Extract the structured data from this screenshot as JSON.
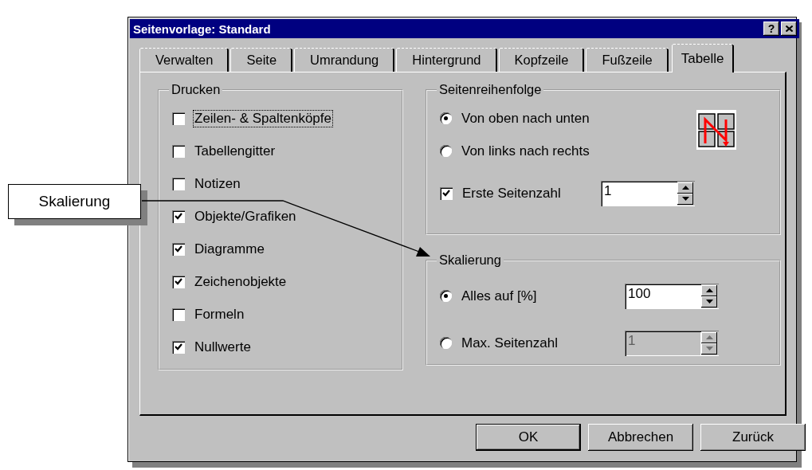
{
  "window": {
    "title": "Seitenvorlage: Standard",
    "help_button": "?"
  },
  "tabs": [
    {
      "label": "Verwalten",
      "selected": false
    },
    {
      "label": "Seite",
      "selected": false
    },
    {
      "label": "Umrandung",
      "selected": false
    },
    {
      "label": "Hintergrund",
      "selected": false
    },
    {
      "label": "Kopfzeile",
      "selected": false
    },
    {
      "label": "Fußzeile",
      "selected": false
    },
    {
      "label": "Tabelle",
      "selected": true
    }
  ],
  "print_group": {
    "title": "Drucken",
    "options": [
      {
        "label": "Zeilen- & Spaltenköpfe",
        "checked": false,
        "focused": true
      },
      {
        "label": "Tabellengitter",
        "checked": false,
        "focused": false
      },
      {
        "label": "Notizen",
        "checked": false,
        "focused": false
      },
      {
        "label": "Objekte/Grafiken",
        "checked": true,
        "focused": false
      },
      {
        "label": "Diagramme",
        "checked": true,
        "focused": false
      },
      {
        "label": "Zeichenobjekte",
        "checked": true,
        "focused": false
      },
      {
        "label": "Formeln",
        "checked": false,
        "focused": false
      },
      {
        "label": "Nullwerte",
        "checked": true,
        "focused": false
      }
    ]
  },
  "page_order": {
    "title": "Seitenreihenfolge",
    "options": [
      {
        "label": "Von oben nach unten",
        "selected": true
      },
      {
        "label": "Von links nach rechts",
        "selected": false
      }
    ],
    "first_page": {
      "label": "Erste Seitenzahl",
      "checked": true,
      "value": "1"
    }
  },
  "scaling": {
    "title": "Skalierung",
    "options": [
      {
        "label": "Alles auf [%]",
        "selected": true,
        "value": "100",
        "disabled": false
      },
      {
        "label": "Max. Seitenzahl",
        "selected": false,
        "value": "1",
        "disabled": true
      }
    ]
  },
  "buttons": [
    {
      "label": "OK",
      "default": true
    },
    {
      "label": "Abbrechen",
      "default": false
    },
    {
      "label": "Zurück",
      "default": false
    }
  ],
  "callout": {
    "label": "Skalierung"
  }
}
